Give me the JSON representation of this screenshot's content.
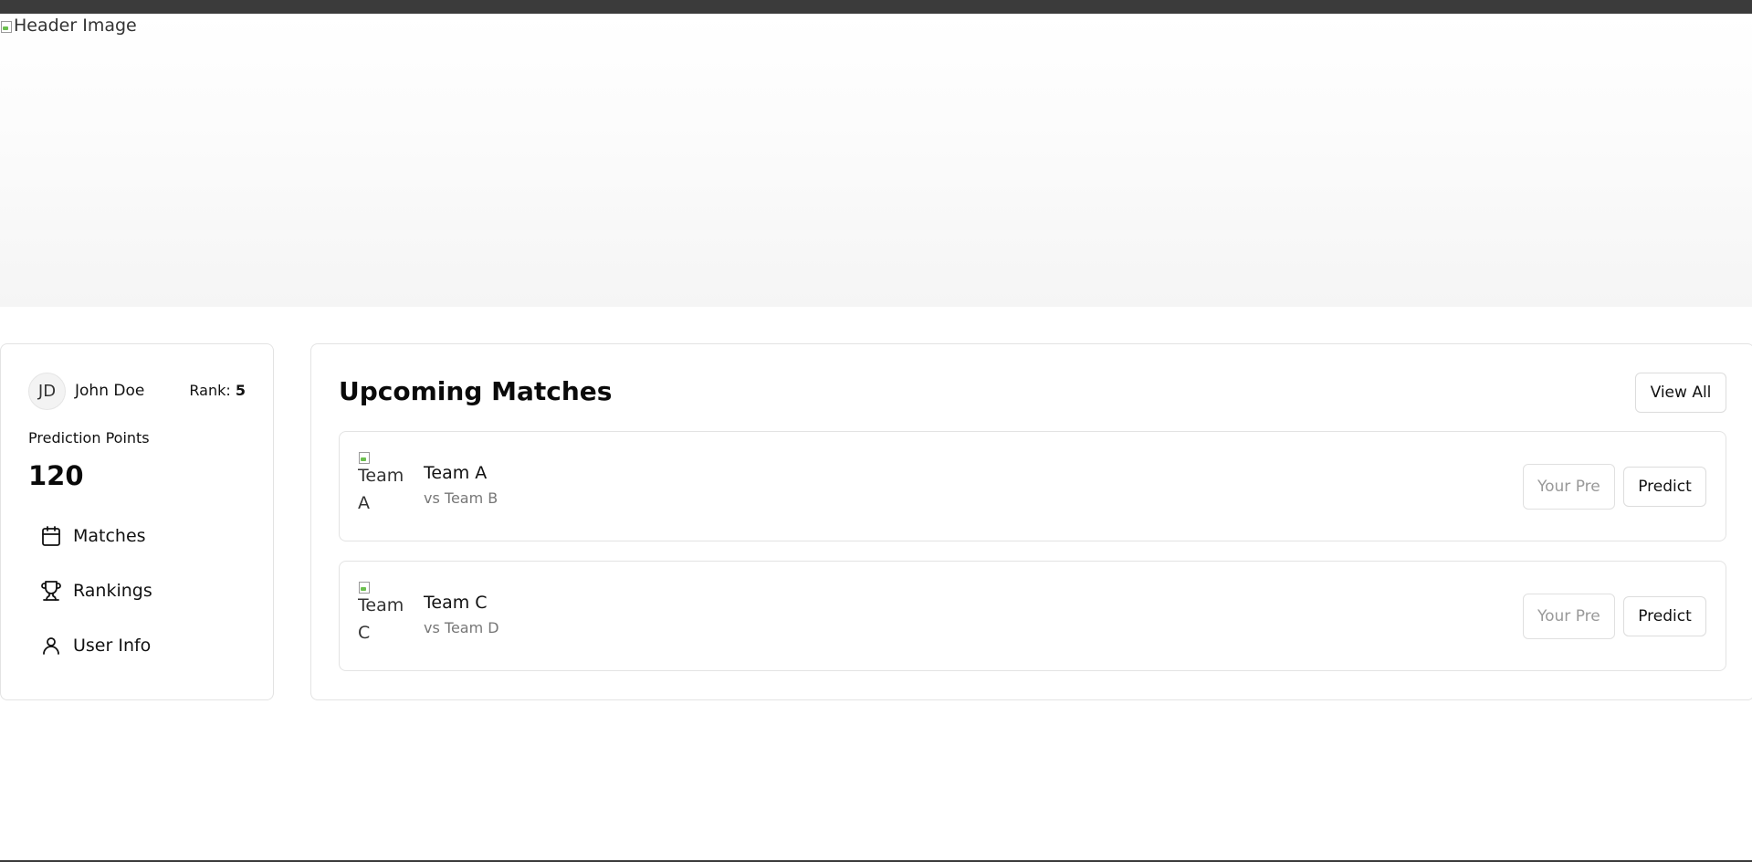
{
  "hero": {
    "image_alt": "Header Image",
    "ghost_title": ""
  },
  "profile": {
    "avatar_initials": "JD",
    "name": "John Doe",
    "rank_label": "Rank:",
    "rank_value": "5",
    "points_label": "Prediction Points",
    "points_value": "120"
  },
  "nav": {
    "items": [
      {
        "label": "Matches",
        "icon": "calendar-icon"
      },
      {
        "label": "Rankings",
        "icon": "trophy-icon"
      },
      {
        "label": "User Info",
        "icon": "user-icon"
      }
    ]
  },
  "matches": {
    "title": "Upcoming Matches",
    "view_all_label": "View All",
    "rows": [
      {
        "logo_alt": "Team A",
        "team": "Team A",
        "opponent": "vs Team B",
        "input_placeholder": "Your Prediction",
        "button_label": "Predict"
      },
      {
        "logo_alt": "Team C",
        "team": "Team C",
        "opponent": "vs Team D",
        "input_placeholder": "Your Prediction",
        "button_label": "Predict"
      }
    ]
  },
  "colors": {
    "text": "#0a0a0a",
    "muted": "#777777",
    "border": "#e3e3e3",
    "topbar": "#3b3b3b"
  }
}
